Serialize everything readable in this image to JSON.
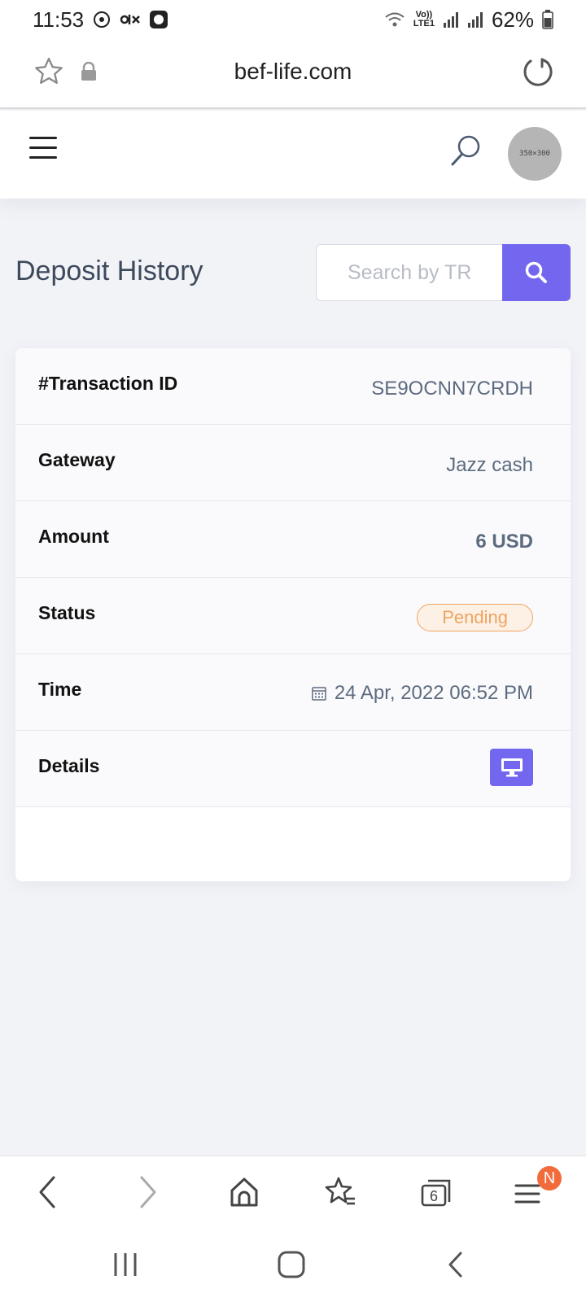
{
  "status_bar": {
    "time": "11:53",
    "network_top": "Vo))",
    "network_bottom": "LTE1",
    "battery": "62%"
  },
  "browser": {
    "url": "bef-life.com",
    "tabs_count": "6",
    "menu_badge": "N"
  },
  "header": {
    "avatar_placeholder": "350×300"
  },
  "page": {
    "title": "Deposit History",
    "search_placeholder": "Search by TR"
  },
  "transaction": {
    "transaction_id_label": "#Transaction ID",
    "transaction_id": "SE9OCNN7CRDH",
    "gateway_label": "Gateway",
    "gateway": "Jazz cash",
    "amount_label": "Amount",
    "amount": "6 USD",
    "status_label": "Status",
    "status": "Pending",
    "time_label": "Time",
    "time": "24 Apr, 2022 06:52 PM",
    "details_label": "Details"
  },
  "colors": {
    "accent": "#7367f0",
    "pending": "#f0a35e",
    "notification": "#f26b3a"
  }
}
